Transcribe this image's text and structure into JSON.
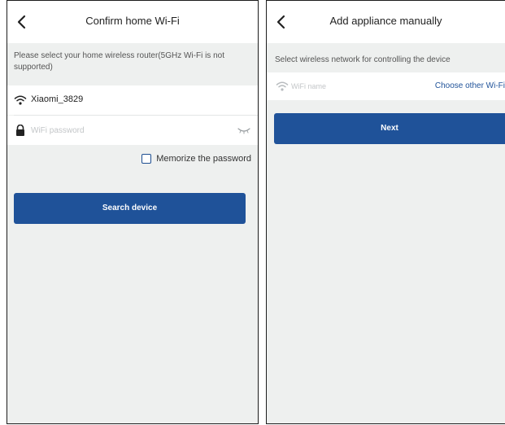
{
  "left_screen": {
    "title": "Confirm home Wi-Fi",
    "instruction": "Please select your home wireless router(5GHz Wi-Fi is not supported)",
    "network_name": "Xiaomi_3829",
    "password_placeholder": "WiFi password",
    "memorize_label": "Memorize the password",
    "memorize_checked": false,
    "search_button": "Search device"
  },
  "right_screen": {
    "title": "Add appliance manually",
    "instruction": "Select wireless network for controlling the device",
    "wifi_name_placeholder": "WiFi name",
    "choose_other_link": "Choose other Wi-Fi",
    "next_button": "Next"
  },
  "icons": {
    "back": "chevron-left-icon",
    "wifi": "wifi-icon",
    "lock": "lock-icon",
    "password_visibility": "eye-closed-icon"
  },
  "colors": {
    "primary": "#1f5299",
    "background": "#eef0ef",
    "surface": "#ffffff"
  }
}
